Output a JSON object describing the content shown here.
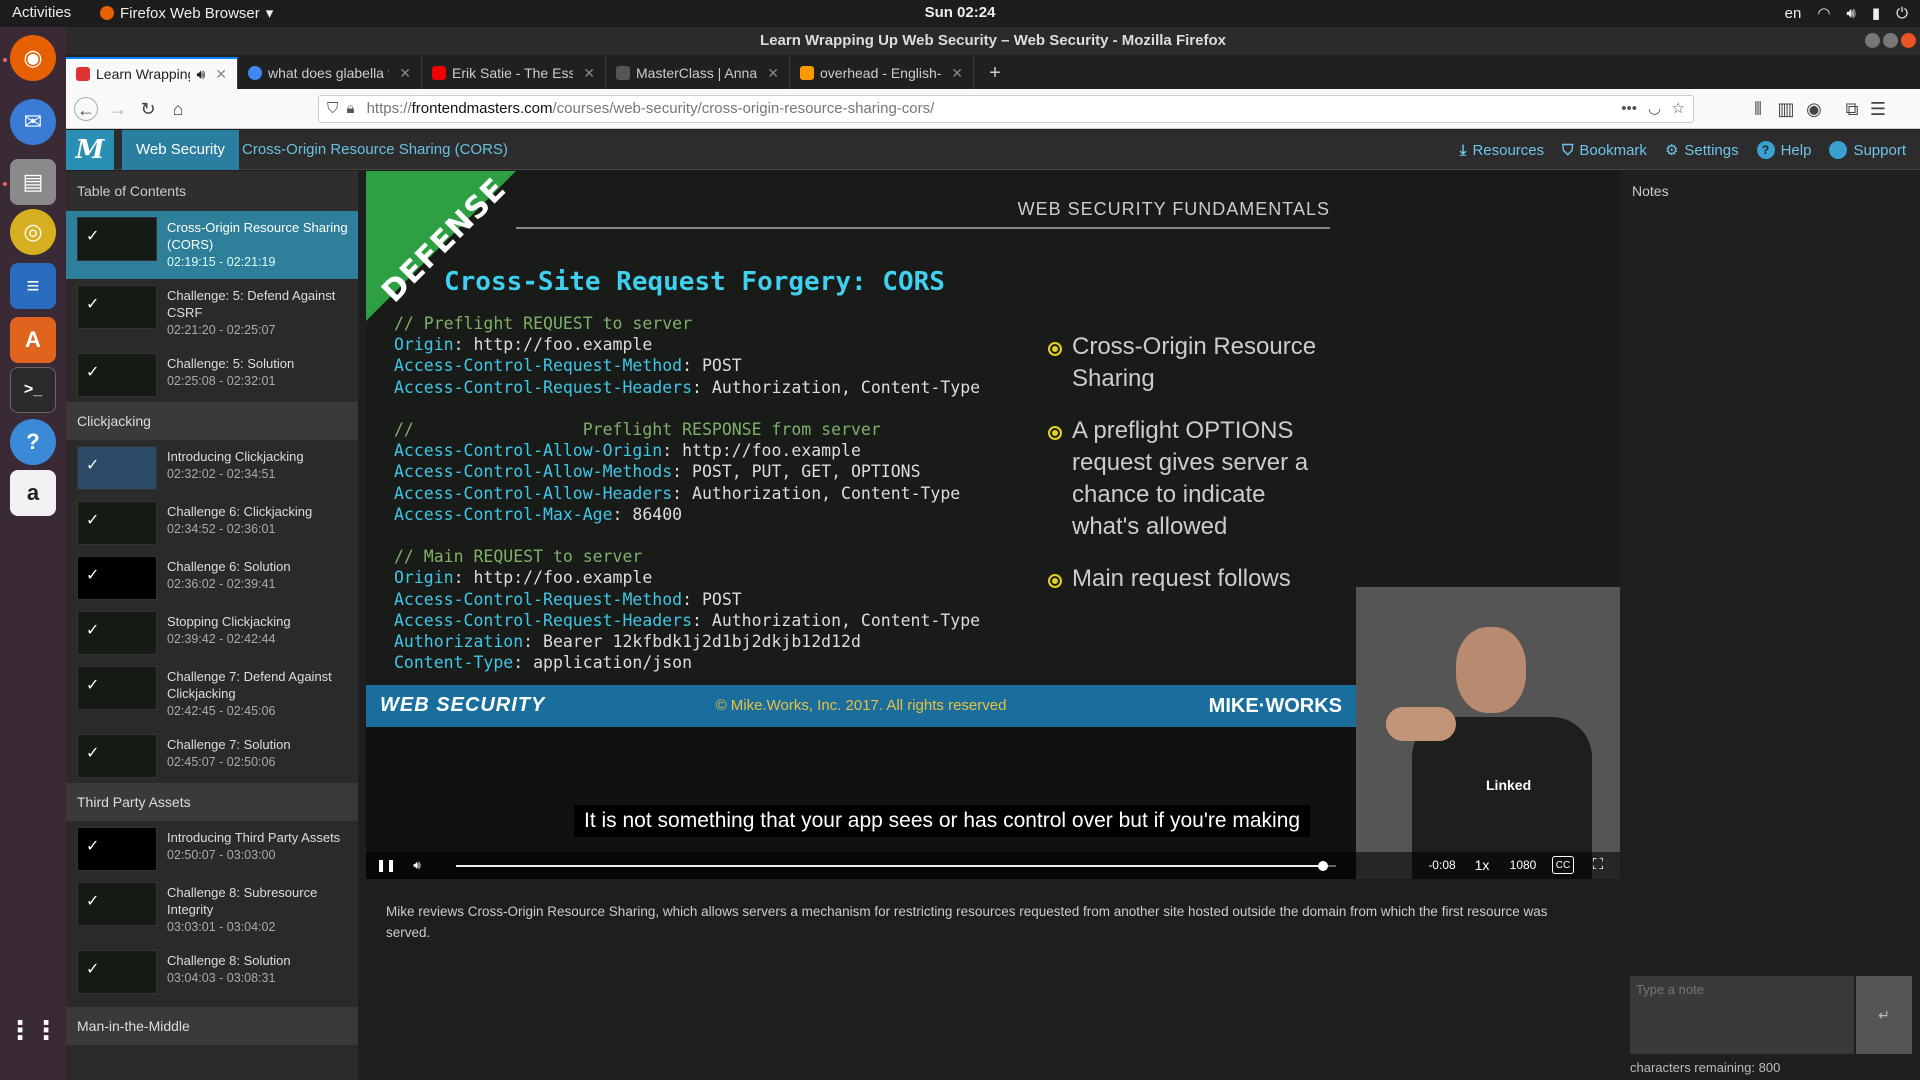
{
  "topbar": {
    "activities": "Activities",
    "app_name": "Firefox Web Browser",
    "clock": "Sun 02:24",
    "lang": "en"
  },
  "window": {
    "title": "Learn Wrapping Up Web Security – Web Security - Mozilla Firefox"
  },
  "tabs": [
    {
      "title": "Learn Wrapping Up We",
      "color": "#d33"
    },
    {
      "title": "what does glabella trans",
      "color": "#4285f4"
    },
    {
      "title": "Erik Satie - The Essential",
      "color": "#e00"
    },
    {
      "title": "MasterClass | Anna Wint",
      "color": "#222"
    },
    {
      "title": "overhead - English-Spani",
      "color": "#f90"
    }
  ],
  "url": {
    "scheme": "https://",
    "host": "frontendmasters.com",
    "path": "/courses/web-security/cross-origin-resource-sharing-cors/"
  },
  "site": {
    "logo": "M",
    "crumb_course": "Web Security",
    "crumb_lesson": "Cross-Origin Resource Sharing (CORS)",
    "links": {
      "resources": "Resources",
      "bookmark": "Bookmark",
      "settings": "Settings",
      "help": "Help",
      "support": "Support"
    }
  },
  "toc": {
    "title": "Table of Contents",
    "items": [
      {
        "title": "Cross-Origin Resource Sharing (CORS)",
        "time": "02:19:15 - 02:21:19"
      },
      {
        "title": "Challenge: 5: Defend Against CSRF",
        "time": "02:21:20 - 02:25:07"
      },
      {
        "title": "Challenge: 5: Solution",
        "time": "02:25:08 - 02:32:01"
      }
    ],
    "sections": [
      {
        "name": "Clickjacking",
        "items": [
          {
            "title": "Introducing Clickjacking",
            "time": "02:32:02 - 02:34:51"
          },
          {
            "title": "Challenge 6: Clickjacking",
            "time": "02:34:52 - 02:36:01"
          },
          {
            "title": "Challenge 6: Solution",
            "time": "02:36:02 - 02:39:41"
          },
          {
            "title": "Stopping Clickjacking",
            "time": "02:39:42 - 02:42:44"
          },
          {
            "title": "Challenge 7: Defend Against Clickjacking",
            "time": "02:42:45 - 02:45:06"
          },
          {
            "title": "Challenge 7: Solution",
            "time": "02:45:07 - 02:50:06"
          }
        ]
      },
      {
        "name": "Third Party Assets",
        "items": [
          {
            "title": "Introducing Third Party Assets",
            "time": "02:50:07 - 03:03:00"
          },
          {
            "title": "Challenge 8: Subresource Integrity",
            "time": "03:03:01 - 03:04:02"
          },
          {
            "title": "Challenge 8: Solution",
            "time": "03:04:03 - 03:08:31"
          }
        ]
      },
      {
        "name": "Man-in-the-Middle",
        "items": []
      }
    ]
  },
  "slide": {
    "ribbon": "DEFENSE",
    "header": "WEB SECURITY FUNDAMENTALS",
    "title": "Cross-Site Request Forgery: CORS",
    "code": {
      "c1": "// Preflight REQUEST to server",
      "l1k": "Origin",
      "l1v": ": http://foo.example",
      "l2k": "Access-Control-Request-Method",
      "l2v": ": POST",
      "l3k": "Access-Control-Request-Headers",
      "l3v": ": Authorization, Content-Type",
      "c2": "//                 Preflight RESPONSE from server",
      "l4k": "Access-Control-Allow-Origin",
      "l4v": ": http://foo.example",
      "l5k": "Access-Control-Allow-Methods",
      "l5v": ": POST, PUT, GET, OPTIONS",
      "l6k": "Access-Control-Allow-Headers",
      "l6v": ": Authorization, Content-Type",
      "l7k": "Access-Control-Max-Age",
      "l7v": ": 86400",
      "c3": "// Main REQUEST to server",
      "l8k": "Origin",
      "l8v": ": http://foo.example",
      "l9k": "Access-Control-Request-Method",
      "l9v": ": POST",
      "l10k": "Access-Control-Request-Headers",
      "l10v": ": Authorization, Content-Type",
      "l11k": "Authorization",
      "l11v": ": Bearer 12kfbdk1j2d1bj2dkjb12d12d",
      "l12k": "Content-Type",
      "l12v": ": application/json"
    },
    "bullets": [
      "Cross-Origin Resource Sharing",
      "A preflight OPTIONS request gives server a chance to indicate what's allowed",
      "Main request follows"
    ],
    "footer_left": "WEB SECURITY",
    "footer_copyright": "© Mike.Works, Inc. 2017. All rights reserved",
    "footer_right": "MIKE·WORKS",
    "presenter_shirt": "Linked"
  },
  "player": {
    "caption": "It is not something that your app sees or has control over but if you're making",
    "time_remaining": "-0:08",
    "speed": "1x",
    "quality": "1080",
    "progress": 0.985
  },
  "description": "Mike reviews Cross-Origin Resource Sharing, which allows servers a mechanism for restricting resources requested from another site hosted outside the domain from which the first resource was served.",
  "notes": {
    "title": "Notes",
    "placeholder": "Type a note",
    "submit": "↵",
    "remaining": "characters remaining: 800"
  }
}
